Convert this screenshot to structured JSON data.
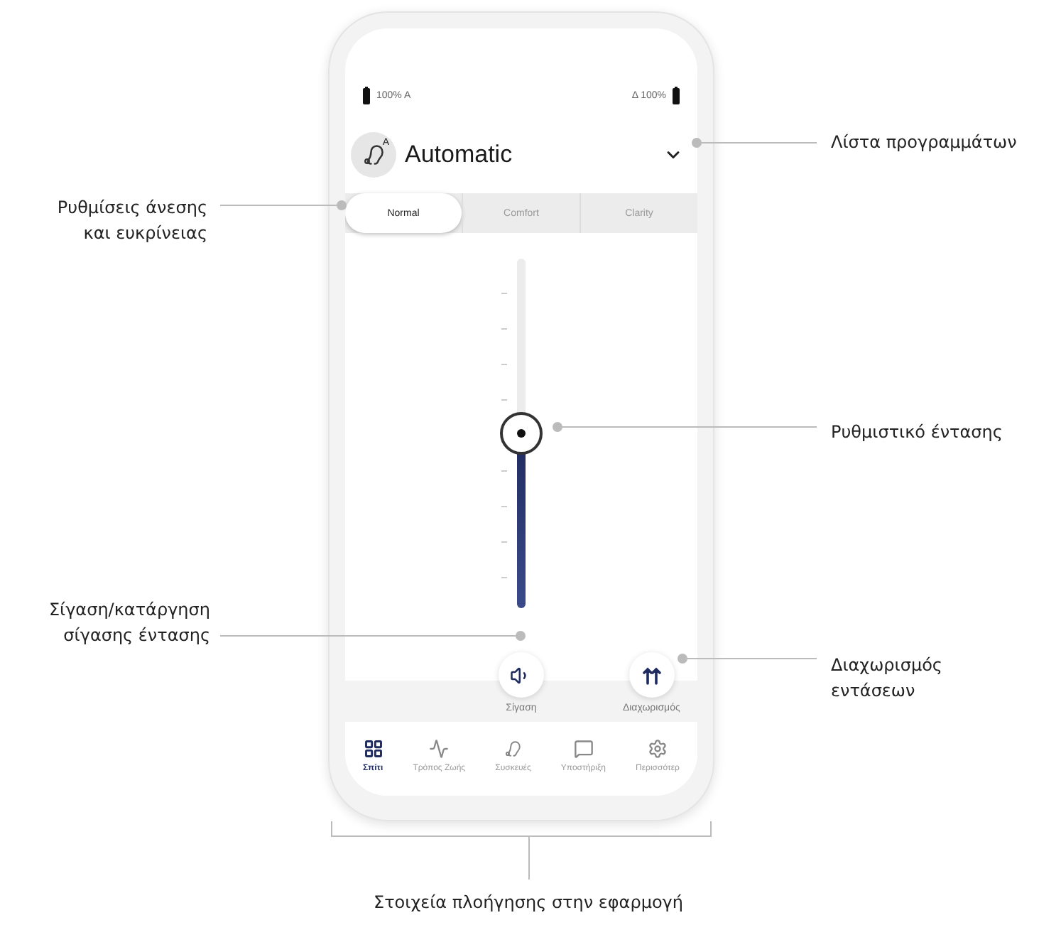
{
  "phone": {
    "status": {
      "left": "100% A",
      "right": "Δ 100%"
    },
    "program": {
      "badge": "A",
      "name": "Automatic"
    },
    "modes": [
      {
        "label": "Normal",
        "selected": true
      },
      {
        "label": "Comfort",
        "selected": false
      },
      {
        "label": "Clarity",
        "selected": false
      }
    ],
    "volume": {
      "level": 0.5
    },
    "controls": [
      {
        "kind": "mute",
        "label": "Σίγαση"
      },
      {
        "kind": "split",
        "label": "Διαχωρισμός"
      }
    ],
    "nav": [
      {
        "kind": "home",
        "label": "Σπίτι",
        "selected": true
      },
      {
        "kind": "lifestyle",
        "label": "Τρόπος Ζωής",
        "selected": false
      },
      {
        "kind": "devices",
        "label": "Συσκευές",
        "selected": false
      },
      {
        "kind": "support",
        "label": "Υποστήριξη",
        "selected": false
      },
      {
        "kind": "more",
        "label": "Περισσότερ",
        "selected": false
      }
    ]
  },
  "annotations": [
    {
      "lines": [
        "Λίστα προγραμμάτων"
      ]
    },
    {
      "lines": [
        "Ρυθμίσεις άνεσης",
        "και ευκρίνειας"
      ]
    },
    {
      "lines": [
        "Ρυθμιστικό έντασης"
      ]
    },
    {
      "lines": [
        "Σίγαση/κατάργηση",
        "σίγασης έντασης"
      ]
    },
    {
      "lines": [
        "Διαχωρισμός",
        "εντάσεων"
      ]
    }
  ],
  "footer_annotation": "Στοιχεία πλοήγησης στην εφαρμογή"
}
